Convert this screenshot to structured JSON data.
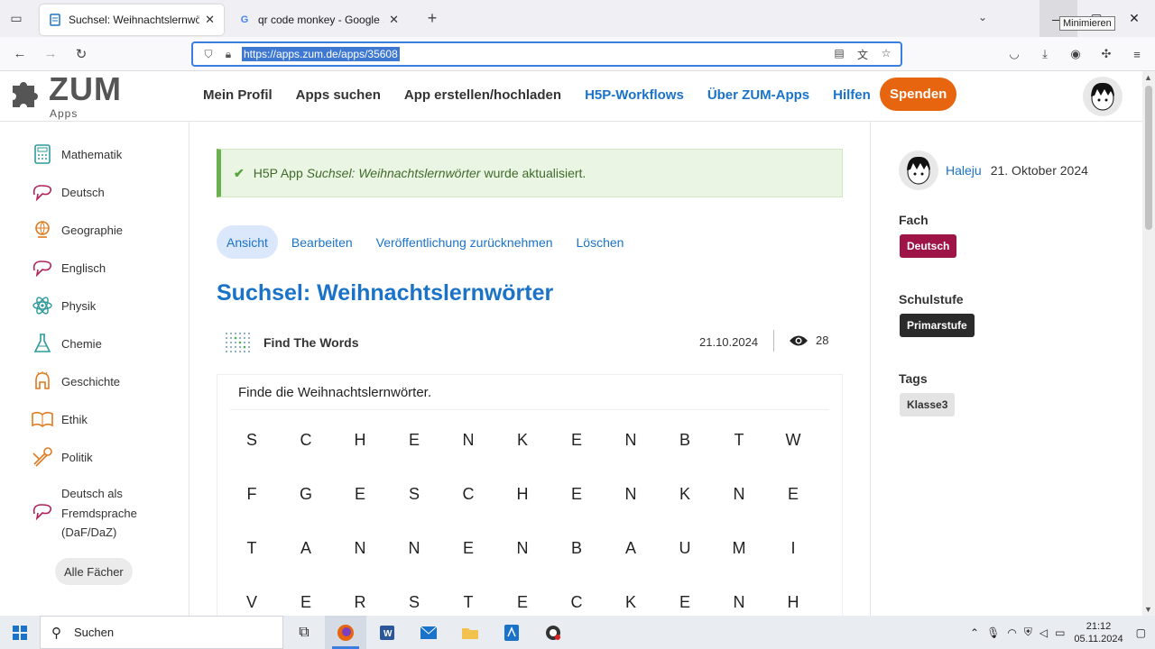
{
  "browser": {
    "tabs": [
      {
        "title": "Suchsel: Weihnachtslernwörter",
        "active": true
      },
      {
        "title": "qr code monkey - Google Such",
        "active": false
      }
    ],
    "url": "https://apps.zum.de/apps/35608",
    "tooltip": "Minimieren"
  },
  "site": {
    "logo_text": "ZUM",
    "logo_sub": "Apps",
    "nav": [
      "Mein Profil",
      "Apps suchen",
      "App erstellen/hochladen",
      "H5P-Workflows",
      "Über ZUM-Apps",
      "Hilfen"
    ],
    "donate": "Spenden"
  },
  "sidebar": {
    "subjects": [
      "Mathematik",
      "Deutsch",
      "Geographie",
      "Englisch",
      "Physik",
      "Chemie",
      "Geschichte",
      "Ethik",
      "Politik"
    ],
    "daf": [
      "Deutsch als",
      "Fremdsprache",
      "(DaF/DaZ)"
    ],
    "all_button": "Alle Fächer"
  },
  "alert": {
    "prefix": "H5P App",
    "app_name": "Suchsel: Weihnachtslernwörter",
    "suffix": "wurde aktualisiert."
  },
  "actions": [
    "Ansicht",
    "Bearbeiten",
    "Veröffentlichung zurücknehmen",
    "Löschen"
  ],
  "page_title": "Suchsel: Weihnachtslernwörter",
  "app": {
    "type": "Find The Words",
    "date": "21.10.2024",
    "views": "28",
    "task": "Finde die Weihnachtslernwörter.",
    "grid": [
      [
        "S",
        "C",
        "H",
        "E",
        "N",
        "K",
        "E",
        "N",
        "B",
        "T",
        "W"
      ],
      [
        "F",
        "G",
        "E",
        "S",
        "C",
        "H",
        "E",
        "N",
        "K",
        "N",
        "E"
      ],
      [
        "T",
        "A",
        "N",
        "N",
        "E",
        "N",
        "B",
        "A",
        "U",
        "M",
        "I"
      ],
      [
        "V",
        "E",
        "R",
        "S",
        "T",
        "E",
        "C",
        "K",
        "E",
        "N",
        "H"
      ]
    ]
  },
  "meta": {
    "author": "Haleju",
    "date": "21. Oktober 2024",
    "fach_label": "Fach",
    "fach": "Deutsch",
    "schulstufe_label": "Schulstufe",
    "schulstufe": "Primarstufe",
    "tags_label": "Tags",
    "tag": "Klasse3",
    "colors": {
      "fach_bg": "#9e1446",
      "stufe_bg": "#2b2b2b",
      "tag_bg": "#e3e3e3",
      "accent": "#1a73c8",
      "donate": "#e8650f"
    }
  },
  "taskbar": {
    "search": "Suchen",
    "time": "21:12",
    "date": "05.11.2024"
  }
}
